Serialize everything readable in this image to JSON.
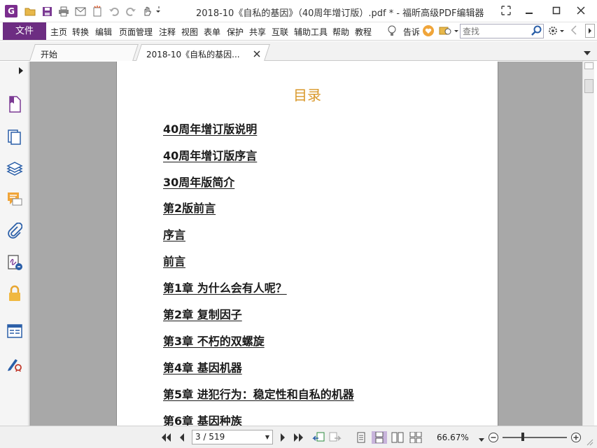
{
  "window": {
    "title": "2018-10《自私的基因》（40周年增订版）.pdf * - 福昕高级PDF编辑器",
    "app_icon": "foxit-logo-icon",
    "accent_color": "#6d2d82"
  },
  "quick_access": [
    "open-folder-icon",
    "save-icon",
    "print-icon",
    "email-icon",
    "new-icon",
    "undo-icon",
    "redo-icon",
    "hand-tool-icon"
  ],
  "menu": {
    "file_label": "文件",
    "items": [
      "主页",
      "转换",
      "编辑",
      "页面管理",
      "注释",
      "视图",
      "表单",
      "保护",
      "共享",
      "互联",
      "辅助工具",
      "帮助",
      "教程"
    ],
    "tell_me": "告诉",
    "search_placeholder": "查找"
  },
  "tabs": [
    {
      "label": "开始"
    },
    {
      "label": "2018-10《自私的基因..."
    }
  ],
  "left_panel_icons": [
    "bookmark-icon",
    "pages-icon",
    "layers-icon",
    "comments-icon",
    "attachments-icon",
    "signature-icon",
    "security-icon",
    "form-fields-icon",
    "sign-tool-icon"
  ],
  "document": {
    "heading": "目录",
    "heading_color": "#d9982a",
    "entries": [
      "40周年增订版说明",
      "40周年增订版序言",
      "30周年版简介",
      "第2版前言",
      "序言",
      "前言",
      "第1章 为什么会有人呢？",
      "第2章 复制因子",
      "第3章 不朽的双螺旋",
      "第4章 基因机器",
      "第5章 进犯行为：稳定性和自私的机器",
      "第6章 基因种族"
    ]
  },
  "status": {
    "page_indicator": "3 / 519",
    "zoom": "66.67%"
  }
}
